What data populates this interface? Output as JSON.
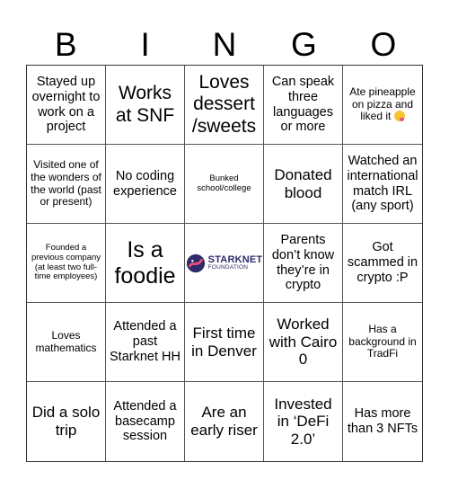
{
  "header": {
    "letters": [
      "B",
      "I",
      "N",
      "G",
      "O"
    ]
  },
  "cells": [
    "Stayed up overnight to work on a project",
    "Works at SNF",
    "Loves dessert /sweets",
    "Can speak three languages or more",
    "Ate pineapple on pizza and liked it",
    "Visited one of the wonders of the world (past or present)",
    "No coding experience",
    "Bunked school/college",
    "Donated blood",
    "Watched an international match IRL (any sport)",
    "Founded a previous company (at least two full-time employees)",
    "Is a foodie",
    "",
    "Parents don’t know they’re in crypto",
    "Got scammed in crypto :P",
    "Loves mathematics",
    "Attended a past Starknet HH",
    "First time in Denver",
    "Worked with Cairo 0",
    "Has a background in TradFi",
    "Did a solo trip",
    "Attended a basecamp session",
    "Are an early riser",
    "Invested in ‘DeFi 2.0’",
    "Has more than 3 NFTs"
  ],
  "center_logo": {
    "line1": "STARKNET",
    "line2": "FOUNDATION",
    "icon": "starknet-logo-icon"
  },
  "emoji": {
    "icon": "face-savoring-food-icon"
  },
  "colors": {
    "logo_navy": "#2e2a6b",
    "logo_pink": "#e8507a",
    "grid_line": "#555555"
  }
}
